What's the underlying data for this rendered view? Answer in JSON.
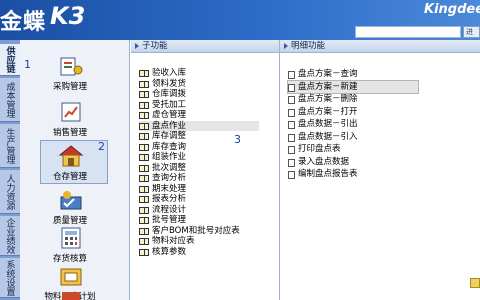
{
  "header": {
    "logo_text": "金蝶",
    "logo_mark": "K3",
    "brand": "Kingdee",
    "search_placeholder": "",
    "search_button": "进"
  },
  "vtabs": [
    {
      "label": "供应链",
      "active": true
    },
    {
      "label": "成本管理",
      "active": false
    },
    {
      "label": "生产管理",
      "active": false
    },
    {
      "label": "人力资源",
      "active": false
    },
    {
      "label": "企业绩效",
      "active": false
    },
    {
      "label": "系统设置",
      "active": false
    }
  ],
  "modules": [
    {
      "label": "采购管理",
      "icon": "purchase-icon"
    },
    {
      "label": "销售管理",
      "icon": "sales-icon"
    },
    {
      "label": "仓存管理",
      "icon": "warehouse-icon",
      "selected": true
    },
    {
      "label": "质量管理",
      "icon": "quality-icon"
    },
    {
      "label": "存货核算",
      "icon": "inventory-accounting-icon"
    },
    {
      "label": "物料需求计划",
      "icon": "material-planning-icon"
    }
  ],
  "badges": {
    "b1": "1",
    "b2": "2",
    "b3": "3",
    "b4": "4"
  },
  "sub_panel": {
    "title": "子功能",
    "items": [
      "验收入库",
      "领料发货",
      "仓库调拨",
      "受托加工",
      "虚仓管理",
      "盘点作业",
      "库存调整",
      "库存查询",
      "组装作业",
      "批次调整",
      "查询分析",
      "期末处理",
      "报表分析",
      "流程设计",
      "批号管理",
      "客户BOM和批号对应表",
      "物料对应表",
      "核算参数"
    ],
    "highlight_index": 5
  },
  "detail_panel": {
    "title": "明细功能",
    "items": [
      "盘点方案－查询",
      "盘点方案－新建",
      "盘点方案－删除",
      "盘点方案－打开",
      "盘点数据－引出",
      "盘点数据－引入",
      "打印盘点表",
      "录入盘点数据",
      "编制盘点报告表"
    ],
    "highlight_index": 1
  }
}
